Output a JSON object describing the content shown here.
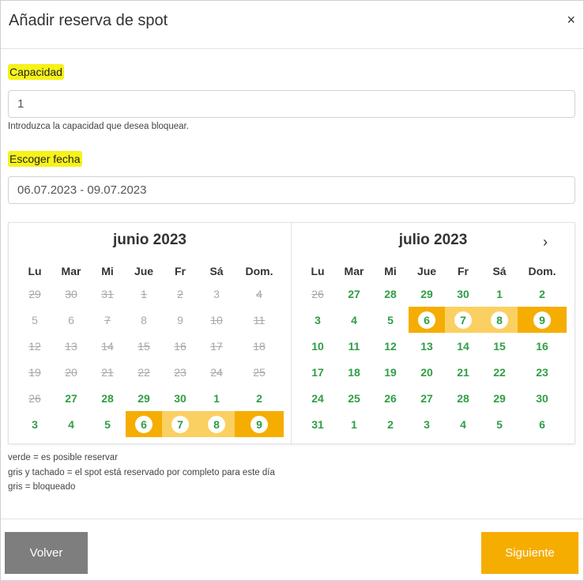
{
  "dialog": {
    "title": "Añadir reserva de spot",
    "close_symbol": "×"
  },
  "capacity": {
    "label": "Capacidad",
    "value": "1",
    "help": "Introduzca la capacidad que desea bloquear."
  },
  "date": {
    "label": "Escoger fecha",
    "value": "06.07.2023 - 09.07.2023"
  },
  "calendar": {
    "weekdays": [
      "Lu",
      "Mar",
      "Mi",
      "Jue",
      "Fr",
      "Sá",
      "Dom."
    ],
    "next_symbol": "›",
    "months": [
      {
        "title": "junio 2023",
        "weeks": [
          [
            {
              "d": "29",
              "s": "booked"
            },
            {
              "d": "30",
              "s": "booked"
            },
            {
              "d": "31",
              "s": "booked"
            },
            {
              "d": "1",
              "s": "booked"
            },
            {
              "d": "2",
              "s": "booked"
            },
            {
              "d": "3",
              "s": "blocked"
            },
            {
              "d": "4",
              "s": "booked"
            }
          ],
          [
            {
              "d": "5",
              "s": "blocked"
            },
            {
              "d": "6",
              "s": "blocked"
            },
            {
              "d": "7",
              "s": "booked"
            },
            {
              "d": "8",
              "s": "blocked"
            },
            {
              "d": "9",
              "s": "blocked"
            },
            {
              "d": "10",
              "s": "booked"
            },
            {
              "d": "11",
              "s": "booked"
            }
          ],
          [
            {
              "d": "12",
              "s": "booked"
            },
            {
              "d": "13",
              "s": "booked"
            },
            {
              "d": "14",
              "s": "booked"
            },
            {
              "d": "15",
              "s": "booked"
            },
            {
              "d": "16",
              "s": "booked"
            },
            {
              "d": "17",
              "s": "booked"
            },
            {
              "d": "18",
              "s": "booked"
            }
          ],
          [
            {
              "d": "19",
              "s": "booked"
            },
            {
              "d": "20",
              "s": "booked"
            },
            {
              "d": "21",
              "s": "booked"
            },
            {
              "d": "22",
              "s": "booked"
            },
            {
              "d": "23",
              "s": "booked"
            },
            {
              "d": "24",
              "s": "booked"
            },
            {
              "d": "25",
              "s": "booked"
            }
          ],
          [
            {
              "d": "26",
              "s": "booked"
            },
            {
              "d": "27",
              "s": "avail"
            },
            {
              "d": "28",
              "s": "avail"
            },
            {
              "d": "29",
              "s": "avail"
            },
            {
              "d": "30",
              "s": "avail"
            },
            {
              "d": "1",
              "s": "avail"
            },
            {
              "d": "2",
              "s": "avail"
            }
          ],
          [
            {
              "d": "3",
              "s": "avail"
            },
            {
              "d": "4",
              "s": "avail"
            },
            {
              "d": "5",
              "s": "avail"
            },
            {
              "d": "6",
              "s": "avail",
              "sel": "start"
            },
            {
              "d": "7",
              "s": "avail",
              "sel": "mid"
            },
            {
              "d": "8",
              "s": "avail",
              "sel": "mid"
            },
            {
              "d": "9",
              "s": "avail",
              "sel": "end"
            }
          ]
        ]
      },
      {
        "title": "julio 2023",
        "weeks": [
          [
            {
              "d": "26",
              "s": "booked"
            },
            {
              "d": "27",
              "s": "avail"
            },
            {
              "d": "28",
              "s": "avail"
            },
            {
              "d": "29",
              "s": "avail"
            },
            {
              "d": "30",
              "s": "avail"
            },
            {
              "d": "1",
              "s": "avail"
            },
            {
              "d": "2",
              "s": "avail"
            }
          ],
          [
            {
              "d": "3",
              "s": "avail"
            },
            {
              "d": "4",
              "s": "avail"
            },
            {
              "d": "5",
              "s": "avail"
            },
            {
              "d": "6",
              "s": "avail",
              "sel": "start"
            },
            {
              "d": "7",
              "s": "avail",
              "sel": "mid"
            },
            {
              "d": "8",
              "s": "avail",
              "sel": "mid"
            },
            {
              "d": "9",
              "s": "avail",
              "sel": "end"
            }
          ],
          [
            {
              "d": "10",
              "s": "avail"
            },
            {
              "d": "11",
              "s": "avail"
            },
            {
              "d": "12",
              "s": "avail"
            },
            {
              "d": "13",
              "s": "avail"
            },
            {
              "d": "14",
              "s": "avail"
            },
            {
              "d": "15",
              "s": "avail"
            },
            {
              "d": "16",
              "s": "avail"
            }
          ],
          [
            {
              "d": "17",
              "s": "avail"
            },
            {
              "d": "18",
              "s": "avail"
            },
            {
              "d": "19",
              "s": "avail"
            },
            {
              "d": "20",
              "s": "avail"
            },
            {
              "d": "21",
              "s": "avail"
            },
            {
              "d": "22",
              "s": "avail"
            },
            {
              "d": "23",
              "s": "avail"
            }
          ],
          [
            {
              "d": "24",
              "s": "avail"
            },
            {
              "d": "25",
              "s": "avail"
            },
            {
              "d": "26",
              "s": "avail"
            },
            {
              "d": "27",
              "s": "avail"
            },
            {
              "d": "28",
              "s": "avail"
            },
            {
              "d": "29",
              "s": "avail"
            },
            {
              "d": "30",
              "s": "avail"
            }
          ],
          [
            {
              "d": "31",
              "s": "avail"
            },
            {
              "d": "1",
              "s": "avail"
            },
            {
              "d": "2",
              "s": "avail"
            },
            {
              "d": "3",
              "s": "avail"
            },
            {
              "d": "4",
              "s": "avail"
            },
            {
              "d": "5",
              "s": "avail"
            },
            {
              "d": "6",
              "s": "avail"
            }
          ]
        ]
      }
    ]
  },
  "legend": [
    "verde = es posible reservar",
    "gris y tachado = el spot está reservado por completo para este día",
    "gris = bloqueado"
  ],
  "footer": {
    "back_label": "Volver",
    "next_label": "Siguiente"
  },
  "colors": {
    "available": "#2f9e44",
    "unavailable": "#a8a8a8",
    "selection": "#f5ad02",
    "selection_range": "#fbd062",
    "highlight": "#f6f21a",
    "back_button": "#7e7e7e"
  }
}
